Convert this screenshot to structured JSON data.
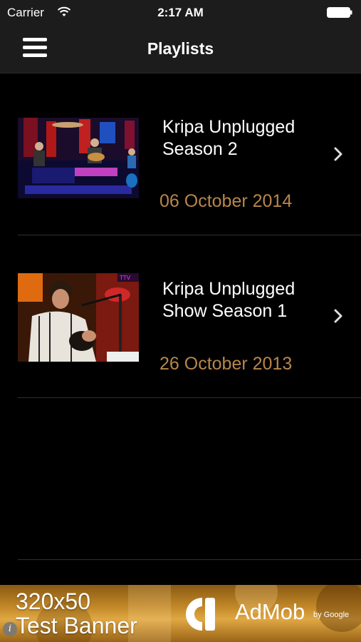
{
  "status_bar": {
    "carrier": "Carrier",
    "time": "2:17 AM"
  },
  "nav": {
    "title": "Playlists",
    "menu_icon": "hamburger-menu-icon"
  },
  "playlists": [
    {
      "title_line1": "Kripa Unplugged",
      "title_line2": "Season 2",
      "date": "06 October 2014"
    },
    {
      "title_line1": "Kripa Unplugged",
      "title_line2": "Show Season 1",
      "date": "26 October 2013",
      "thumb_badge": "TTV"
    }
  ],
  "ad_banner": {
    "line1": "320x50",
    "line2": "Test Banner",
    "brand": "AdMob",
    "byline": "by Google"
  },
  "colors": {
    "background": "#000000",
    "bar": "#1c1c1c",
    "date": "#b8864a",
    "separator": "#2e2e2e"
  }
}
